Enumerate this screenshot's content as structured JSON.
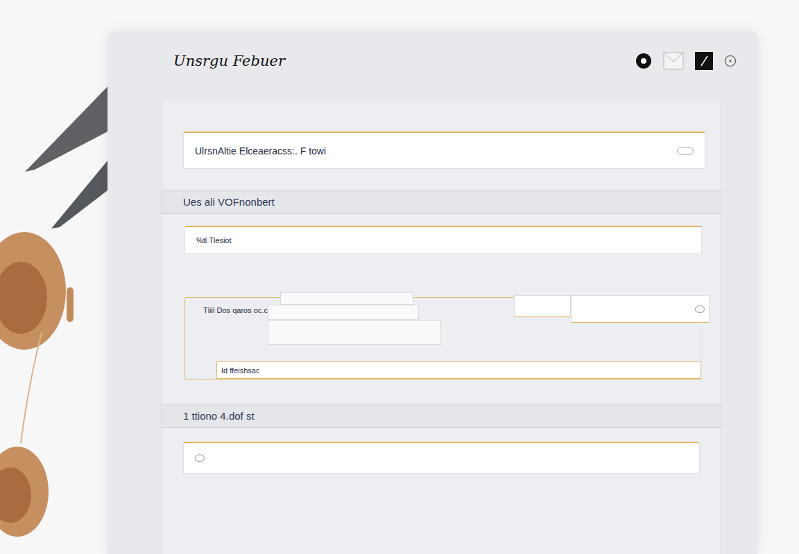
{
  "window": {
    "title": "Unsrgu Febuer"
  },
  "search": {
    "value": "UlrsnAltie Elceaeracss:. F towi"
  },
  "section_one": {
    "heading": "Ues ali VOFnonbert",
    "field": "%tl Tlesiot",
    "group_label": "Tliil Dos qaros oc.c",
    "footer_field": "Id ffeishsac"
  },
  "section_two": {
    "heading": "1 ttiono 4.dof st"
  }
}
